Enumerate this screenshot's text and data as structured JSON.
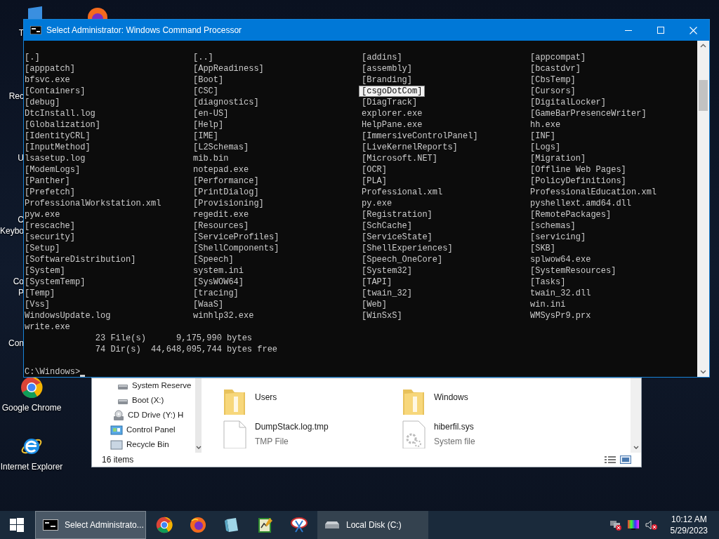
{
  "desktop": {
    "partial_labels": [
      {
        "text": "T"
      },
      {
        "text": "Rec"
      },
      {
        "text": "U"
      },
      {
        "text": "C"
      },
      {
        "text": "Keybo"
      },
      {
        "text": "Co"
      },
      {
        "text": "P"
      },
      {
        "text": "Con"
      }
    ],
    "icons": [
      {
        "label": "Google Chrome"
      },
      {
        "label": "Internet Explorer"
      }
    ]
  },
  "console_window": {
    "title": "Select Administrator: Windows Command Processor",
    "listing": [
      [
        {
          "text": "[.]",
          "selected": false
        },
        {
          "text": "[..]",
          "selected": false
        },
        {
          "text": "[addins]",
          "selected": false
        },
        {
          "text": "[appcompat]",
          "selected": false
        }
      ],
      [
        {
          "text": "[apppatch]",
          "selected": false
        },
        {
          "text": "[AppReadiness]",
          "selected": false
        },
        {
          "text": "[assembly]",
          "selected": false
        },
        {
          "text": "[bcastdvr]",
          "selected": false
        }
      ],
      [
        {
          "text": "bfsvc.exe",
          "selected": false
        },
        {
          "text": "[Boot]",
          "selected": false
        },
        {
          "text": "[Branding]",
          "selected": false
        },
        {
          "text": "[CbsTemp]",
          "selected": false
        }
      ],
      [
        {
          "text": "[Containers]",
          "selected": false
        },
        {
          "text": "[CSC]",
          "selected": false
        },
        {
          "text": "[csgoDotCom]",
          "selected": true
        },
        {
          "text": "[Cursors]",
          "selected": false
        }
      ],
      [
        {
          "text": "[debug]",
          "selected": false
        },
        {
          "text": "[diagnostics]",
          "selected": false
        },
        {
          "text": "[DiagTrack]",
          "selected": false
        },
        {
          "text": "[DigitalLocker]",
          "selected": false
        }
      ],
      [
        {
          "text": "DtcInstall.log",
          "selected": false
        },
        {
          "text": "[en-US]",
          "selected": false
        },
        {
          "text": "explorer.exe",
          "selected": false
        },
        {
          "text": "[GameBarPresenceWriter]",
          "selected": false
        }
      ],
      [
        {
          "text": "[Globalization]",
          "selected": false
        },
        {
          "text": "[Help]",
          "selected": false
        },
        {
          "text": "HelpPane.exe",
          "selected": false
        },
        {
          "text": "hh.exe",
          "selected": false
        }
      ],
      [
        {
          "text": "[IdentityCRL]",
          "selected": false
        },
        {
          "text": "[IME]",
          "selected": false
        },
        {
          "text": "[ImmersiveControlPanel]",
          "selected": false
        },
        {
          "text": "[INF]",
          "selected": false
        }
      ],
      [
        {
          "text": "[InputMethod]",
          "selected": false
        },
        {
          "text": "[L2Schemas]",
          "selected": false
        },
        {
          "text": "[LiveKernelReports]",
          "selected": false
        },
        {
          "text": "[Logs]",
          "selected": false
        }
      ],
      [
        {
          "text": "lsasetup.log",
          "selected": false
        },
        {
          "text": "mib.bin",
          "selected": false
        },
        {
          "text": "[Microsoft.NET]",
          "selected": false
        },
        {
          "text": "[Migration]",
          "selected": false
        }
      ],
      [
        {
          "text": "[ModemLogs]",
          "selected": false
        },
        {
          "text": "notepad.exe",
          "selected": false
        },
        {
          "text": "[OCR]",
          "selected": false
        },
        {
          "text": "[Offline Web Pages]",
          "selected": false
        }
      ],
      [
        {
          "text": "[Panther]",
          "selected": false
        },
        {
          "text": "[Performance]",
          "selected": false
        },
        {
          "text": "[PLA]",
          "selected": false
        },
        {
          "text": "[PolicyDefinitions]",
          "selected": false
        }
      ],
      [
        {
          "text": "[Prefetch]",
          "selected": false
        },
        {
          "text": "[PrintDialog]",
          "selected": false
        },
        {
          "text": "Professional.xml",
          "selected": false
        },
        {
          "text": "ProfessionalEducation.xml",
          "selected": false
        }
      ],
      [
        {
          "text": "ProfessionalWorkstation.xml",
          "selected": false
        },
        {
          "text": "[Provisioning]",
          "selected": false
        },
        {
          "text": "py.exe",
          "selected": false
        },
        {
          "text": "pyshellext.amd64.dll",
          "selected": false
        }
      ],
      [
        {
          "text": "pyw.exe",
          "selected": false
        },
        {
          "text": "regedit.exe",
          "selected": false
        },
        {
          "text": "[Registration]",
          "selected": false
        },
        {
          "text": "[RemotePackages]",
          "selected": false
        }
      ],
      [
        {
          "text": "[rescache]",
          "selected": false
        },
        {
          "text": "[Resources]",
          "selected": false
        },
        {
          "text": "[SchCache]",
          "selected": false
        },
        {
          "text": "[schemas]",
          "selected": false
        }
      ],
      [
        {
          "text": "[security]",
          "selected": false
        },
        {
          "text": "[ServiceProfiles]",
          "selected": false
        },
        {
          "text": "[ServiceState]",
          "selected": false
        },
        {
          "text": "[servicing]",
          "selected": false
        }
      ],
      [
        {
          "text": "[Setup]",
          "selected": false
        },
        {
          "text": "[ShellComponents]",
          "selected": false
        },
        {
          "text": "[ShellExperiences]",
          "selected": false
        },
        {
          "text": "[SKB]",
          "selected": false
        }
      ],
      [
        {
          "text": "[SoftwareDistribution]",
          "selected": false
        },
        {
          "text": "[Speech]",
          "selected": false
        },
        {
          "text": "[Speech_OneCore]",
          "selected": false
        },
        {
          "text": "splwow64.exe",
          "selected": false
        }
      ],
      [
        {
          "text": "[System]",
          "selected": false
        },
        {
          "text": "system.ini",
          "selected": false
        },
        {
          "text": "[System32]",
          "selected": false
        },
        {
          "text": "[SystemResources]",
          "selected": false
        }
      ],
      [
        {
          "text": "[SystemTemp]",
          "selected": false
        },
        {
          "text": "[SysWOW64]",
          "selected": false
        },
        {
          "text": "[TAPI]",
          "selected": false
        },
        {
          "text": "[Tasks]",
          "selected": false
        }
      ],
      [
        {
          "text": "[Temp]",
          "selected": false
        },
        {
          "text": "[tracing]",
          "selected": false
        },
        {
          "text": "[twain_32]",
          "selected": false
        },
        {
          "text": "twain_32.dll",
          "selected": false
        }
      ],
      [
        {
          "text": "[Vss]",
          "selected": false
        },
        {
          "text": "[WaaS]",
          "selected": false
        },
        {
          "text": "[Web]",
          "selected": false
        },
        {
          "text": "win.ini",
          "selected": false
        }
      ],
      [
        {
          "text": "WindowsUpdate.log",
          "selected": false
        },
        {
          "text": "winhlp32.exe",
          "selected": false
        },
        {
          "text": "[WinSxS]",
          "selected": false
        },
        {
          "text": "WMSysPr9.prx",
          "selected": false
        }
      ],
      [
        {
          "text": "write.exe",
          "selected": false
        }
      ]
    ],
    "summary": [
      "              23 File(s)      9,175,990 bytes",
      "              74 Dir(s)  44,648,095,744 bytes free"
    ],
    "prompt": "C:\\Windows>"
  },
  "explorer_window": {
    "nav_items": [
      {
        "label": "System Reserve",
        "kind": "drive"
      },
      {
        "label": "Boot (X:)",
        "kind": "drive"
      },
      {
        "label": "CD Drive (Y:) H",
        "kind": "cd"
      },
      {
        "label": "Control Panel",
        "kind": "panel"
      },
      {
        "label": "Recycle Bin",
        "kind": "bin"
      }
    ],
    "files": [
      {
        "name": "Users",
        "kind": "folder"
      },
      {
        "name": "Windows",
        "kind": "folder"
      },
      {
        "name": "DumpStack.log.tmp",
        "type": "TMP File",
        "kind": "file"
      },
      {
        "name": "hiberfil.sys",
        "type": "System file",
        "kind": "sysfile"
      }
    ],
    "status": "16 items"
  },
  "taskbar": {
    "windows": [
      {
        "label": "Select Administrato...",
        "active": true,
        "kind": "console"
      },
      {
        "label": "Local Disk (C:)",
        "active": false,
        "kind": "drive"
      }
    ],
    "time": "10:12 AM",
    "date": "5/29/2023"
  }
}
